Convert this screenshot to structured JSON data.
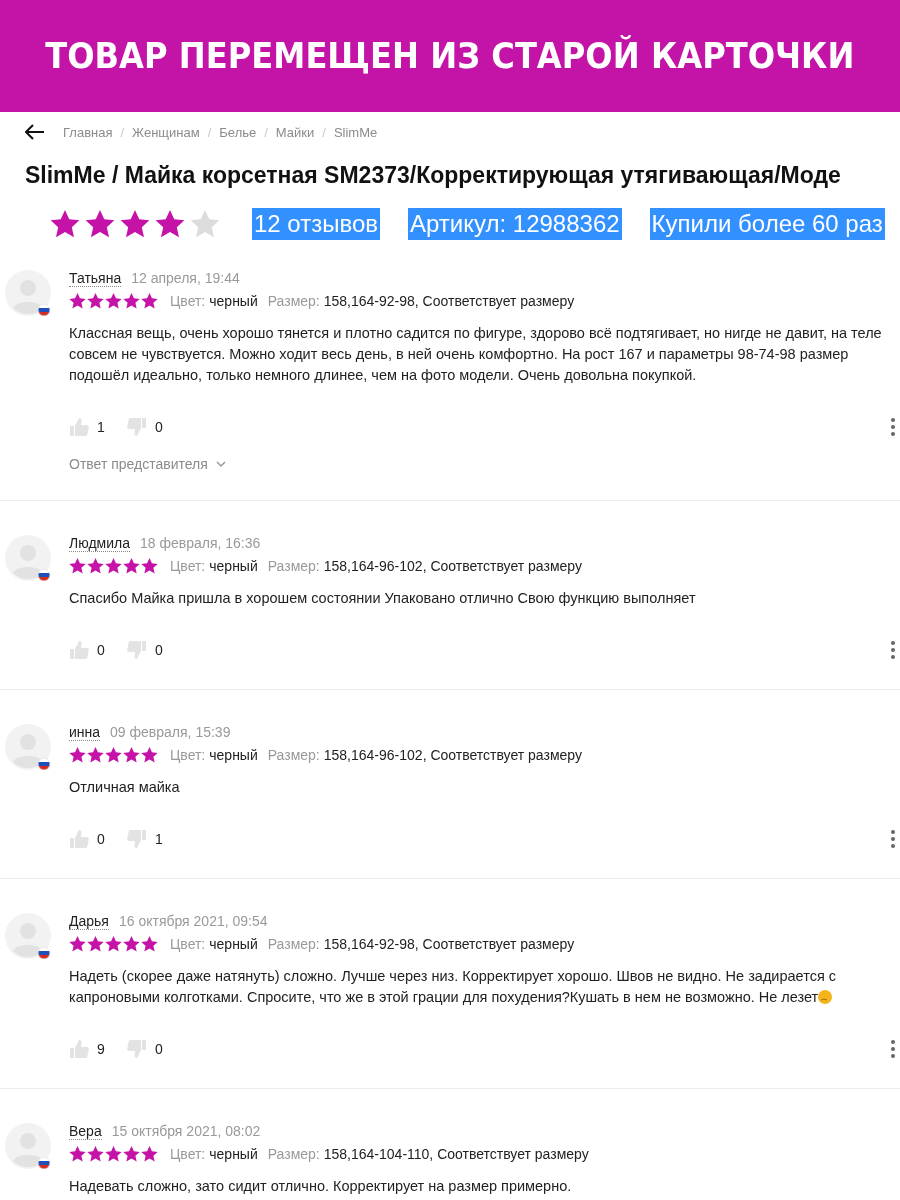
{
  "banner": {
    "title": "ТОВАР ПЕРЕМЕЩЕН ИЗ СТАРОЙ КАРТОЧКИ"
  },
  "breadcrumbs": [
    "Главная",
    "Женщинам",
    "Белье",
    "Майки",
    "SlimMe"
  ],
  "breadcrumb_separator": "/",
  "product": {
    "title": "SlimMe / Майка корсетная SM2373/Корректирующая утягивающая/Моде",
    "stars": 4,
    "highlights": [
      "12 отзывов",
      "Артикул: 12988362",
      "Купили более 60 раз"
    ]
  },
  "reviews": [
    {
      "author": "Татьяна",
      "date": "12 апреля, 19:44",
      "stars": 5,
      "color_label": "Цвет:",
      "color_value": "черный",
      "size_label": "Размер:",
      "size_value": "158,164-92-98, Соответствует размеру",
      "text": "Классная вещь, очень хорошо тянется и плотно садится по фигуре, здорово всё подтягивает, но нигде не давит, на теле совсем не чувствуется. Можно ходит весь день, в ней очень комфортно. На рост 167 и параметры 98-74-98 размер подошёл идеально, только немного длинее, чем на фото модели. Очень довольна покупкой.",
      "emoji": false,
      "likes": "1",
      "dislikes": "0",
      "reply_toggle": "Ответ представителя"
    },
    {
      "author": "Людмила",
      "date": "18 февраля, 16:36",
      "stars": 5,
      "color_label": "Цвет:",
      "color_value": "черный",
      "size_label": "Размер:",
      "size_value": "158,164-96-102, Соответствует размеру",
      "text": "Спасибо Майка пришла в хорошем состоянии Упаковано отлично Свою функцию выполняет",
      "emoji": false,
      "likes": "0",
      "dislikes": "0"
    },
    {
      "author": "инна",
      "date": "09 февраля, 15:39",
      "stars": 5,
      "color_label": "Цвет:",
      "color_value": "черный",
      "size_label": "Размер:",
      "size_value": "158,164-96-102, Соответствует размеру",
      "text": "Отличная майка",
      "emoji": false,
      "likes": "0",
      "dislikes": "1"
    },
    {
      "author": "Дарья",
      "date": "16 октября 2021, 09:54",
      "stars": 5,
      "color_label": "Цвет:",
      "color_value": "черный",
      "size_label": "Размер:",
      "size_value": "158,164-92-98, Соответствует размеру",
      "text": "Надеть (скорее даже натянуть) сложно. Лучше через низ. Корректирует хорошо. Швов не видно. Не задирается с капроновыми колготками. Спросите, что же в этой грации для похудения?Кушать в нем не возможно. Не лезет",
      "emoji": true,
      "likes": "9",
      "dislikes": "0"
    },
    {
      "author": "Вера",
      "date": "15 октября 2021, 08:02",
      "stars": 5,
      "color_label": "Цвет:",
      "color_value": "черный",
      "size_label": "Размер:",
      "size_value": "158,164-104-110, Соответствует размеру",
      "text": "Надевать сложно, зато сидит отлично. Корректирует на размер примерно.",
      "emoji": false
    }
  ]
}
